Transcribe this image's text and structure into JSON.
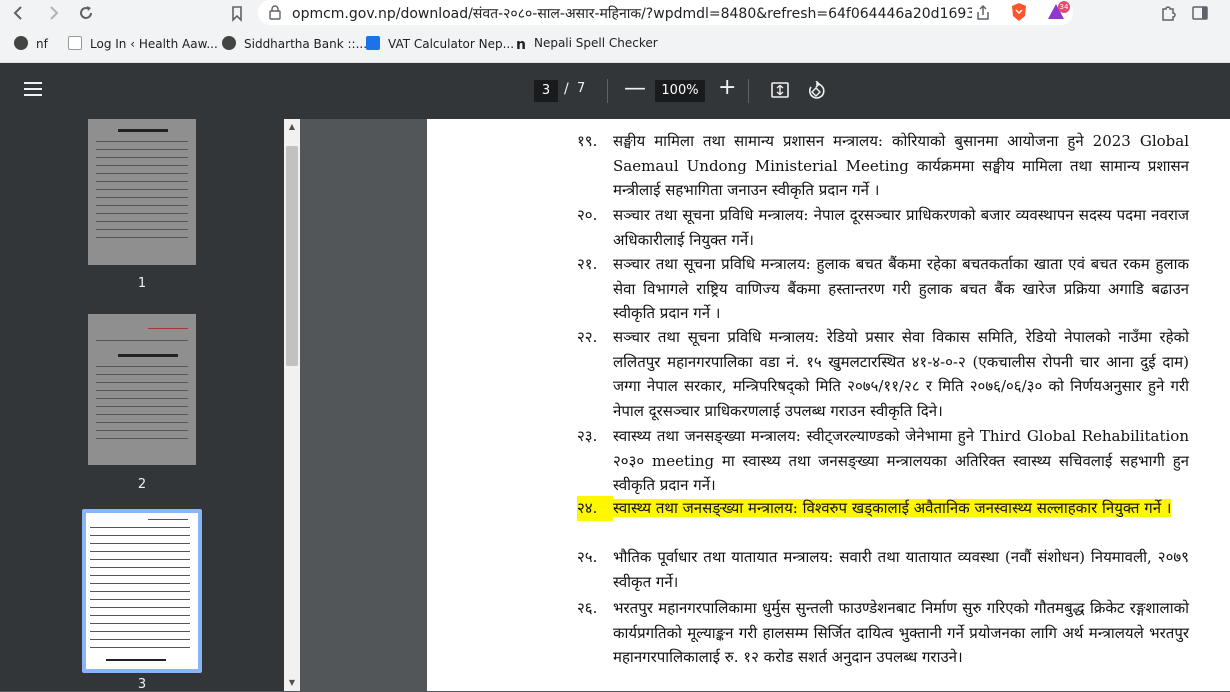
{
  "browser": {
    "url": "opmcm.gov.np/download/संवत-२०८०-साल-असार-महिनाक/?wpdmdl=8480&refresh=64f064446a20d1693475...",
    "brave_badge": "34",
    "bookmarks": [
      {
        "label": "nf"
      },
      {
        "label": "Log In ‹ Health Aaw..."
      },
      {
        "label": "Siddhartha Bank ::..."
      },
      {
        "label": "VAT Calculator Nep..."
      },
      {
        "label": "Nepali Spell Checker"
      }
    ]
  },
  "pdf": {
    "current_page": "3",
    "separator": "/",
    "total_pages": "7",
    "zoom": "100%",
    "minus": "—",
    "plus": "+",
    "thumbnails": [
      {
        "num": "1"
      },
      {
        "num": "2"
      },
      {
        "num": "3"
      }
    ],
    "items": [
      {
        "num": "१९.",
        "text": "सङ्घीय मामिला तथा सामान्य प्रशासन मन्त्रालय: कोरियाको बुसानमा आयोजना हुने 2023 Global Saemaul Undong Ministerial Meeting कार्यक्रममा सङ्घीय मामिला तथा सामान्य प्रशासन मन्त्रीलाई सहभागिता जनाउन स्वीकृति प्रदान गर्ने ।"
      },
      {
        "num": "२०.",
        "text": "सञ्चार तथा सूचना प्रविधि मन्त्रालय: नेपाल दूरसञ्चार प्राधिकरणको बजार व्यवस्थापन सदस्य पदमा नवराज अधिकारीलाई नियुक्त गर्ने।"
      },
      {
        "num": "२१.",
        "text": "सञ्चार तथा सूचना प्रविधि मन्त्रालय: हुलाक बचत बैंकमा रहेका बचतकर्ताका खाता एवं बचत रकम हुलाक सेवा विभागले राष्ट्रिय वाणिज्य बैंकमा हस्तान्तरण गरी हुलाक बचत बैंक खारेज प्रक्रिया अगाडि बढाउन स्वीकृति प्रदान गर्ने ।"
      },
      {
        "num": "२२.",
        "text": "सञ्चार तथा सूचना प्रविधि मन्त्रालय: रेडियो प्रसार सेवा विकास समिति, रेडियो नेपालको नाउँमा रहेको ललितपुर महानगरपालिका वडा नं. १५ खुमलटारस्थित ४१-४-०-२ (एकचालीस रोपनी चार आना दुई दाम) जग्गा नेपाल सरकार, मन्त्रिपरिषद्को मिति २०७५/११/२८ र मिति २०७६/०६/३० को निर्णयअनुसार हुने गरी नेपाल दूरसञ्चार प्राधिकरणलाई उपलब्ध गराउन स्वीकृति दिने।"
      },
      {
        "num": "२३.",
        "text": "स्वास्थ्य तथा जनसङ्ख्या मन्त्रालय: स्वीट्जरल्याण्डको जेनेभामा हुने Third Global Rehabilitation २०३० meeting मा स्वास्थ्य तथा जनसङ्ख्या मन्त्रालयका अतिरिक्त स्वास्थ्य सचिवलाई सहभागी हुन स्वीकृति प्रदान गर्ने।"
      },
      {
        "num": "२४.",
        "text": "स्वास्थ्य तथा जनसङ्ख्या मन्त्रालय: विश्वरुप खड्कालाई अवैतानिक जनस्वास्थ्य सल्लाहकार नियुक्त गर्ने ।"
      },
      {
        "num": "२५.",
        "text": "भौतिक पूर्वाधार तथा यातायात मन्त्रालय: सवारी तथा यातायात व्यवस्था (नवौं संशोधन) नियमावली, २०७९ स्वीकृत गर्ने।"
      },
      {
        "num": "२६.",
        "text": "भरतपुर महानगरपालिकामा धुर्मुस सुन्तली फाउण्डेशनबाट निर्माण सुरु गरिएको गौतमबुद्ध क्रिकेट रङ्गशालाको कार्यप्रगतिको मूल्याङ्कन गरी हालसम्म सिर्जित दायित्व भुक्तानी गर्ने प्रयोजनका लागि अर्थ मन्त्रालयले भरतपुर महानगरपालिकालाई रु. १२ करोड सशर्त अनुदान उपलब्ध गराउने।"
      }
    ]
  }
}
